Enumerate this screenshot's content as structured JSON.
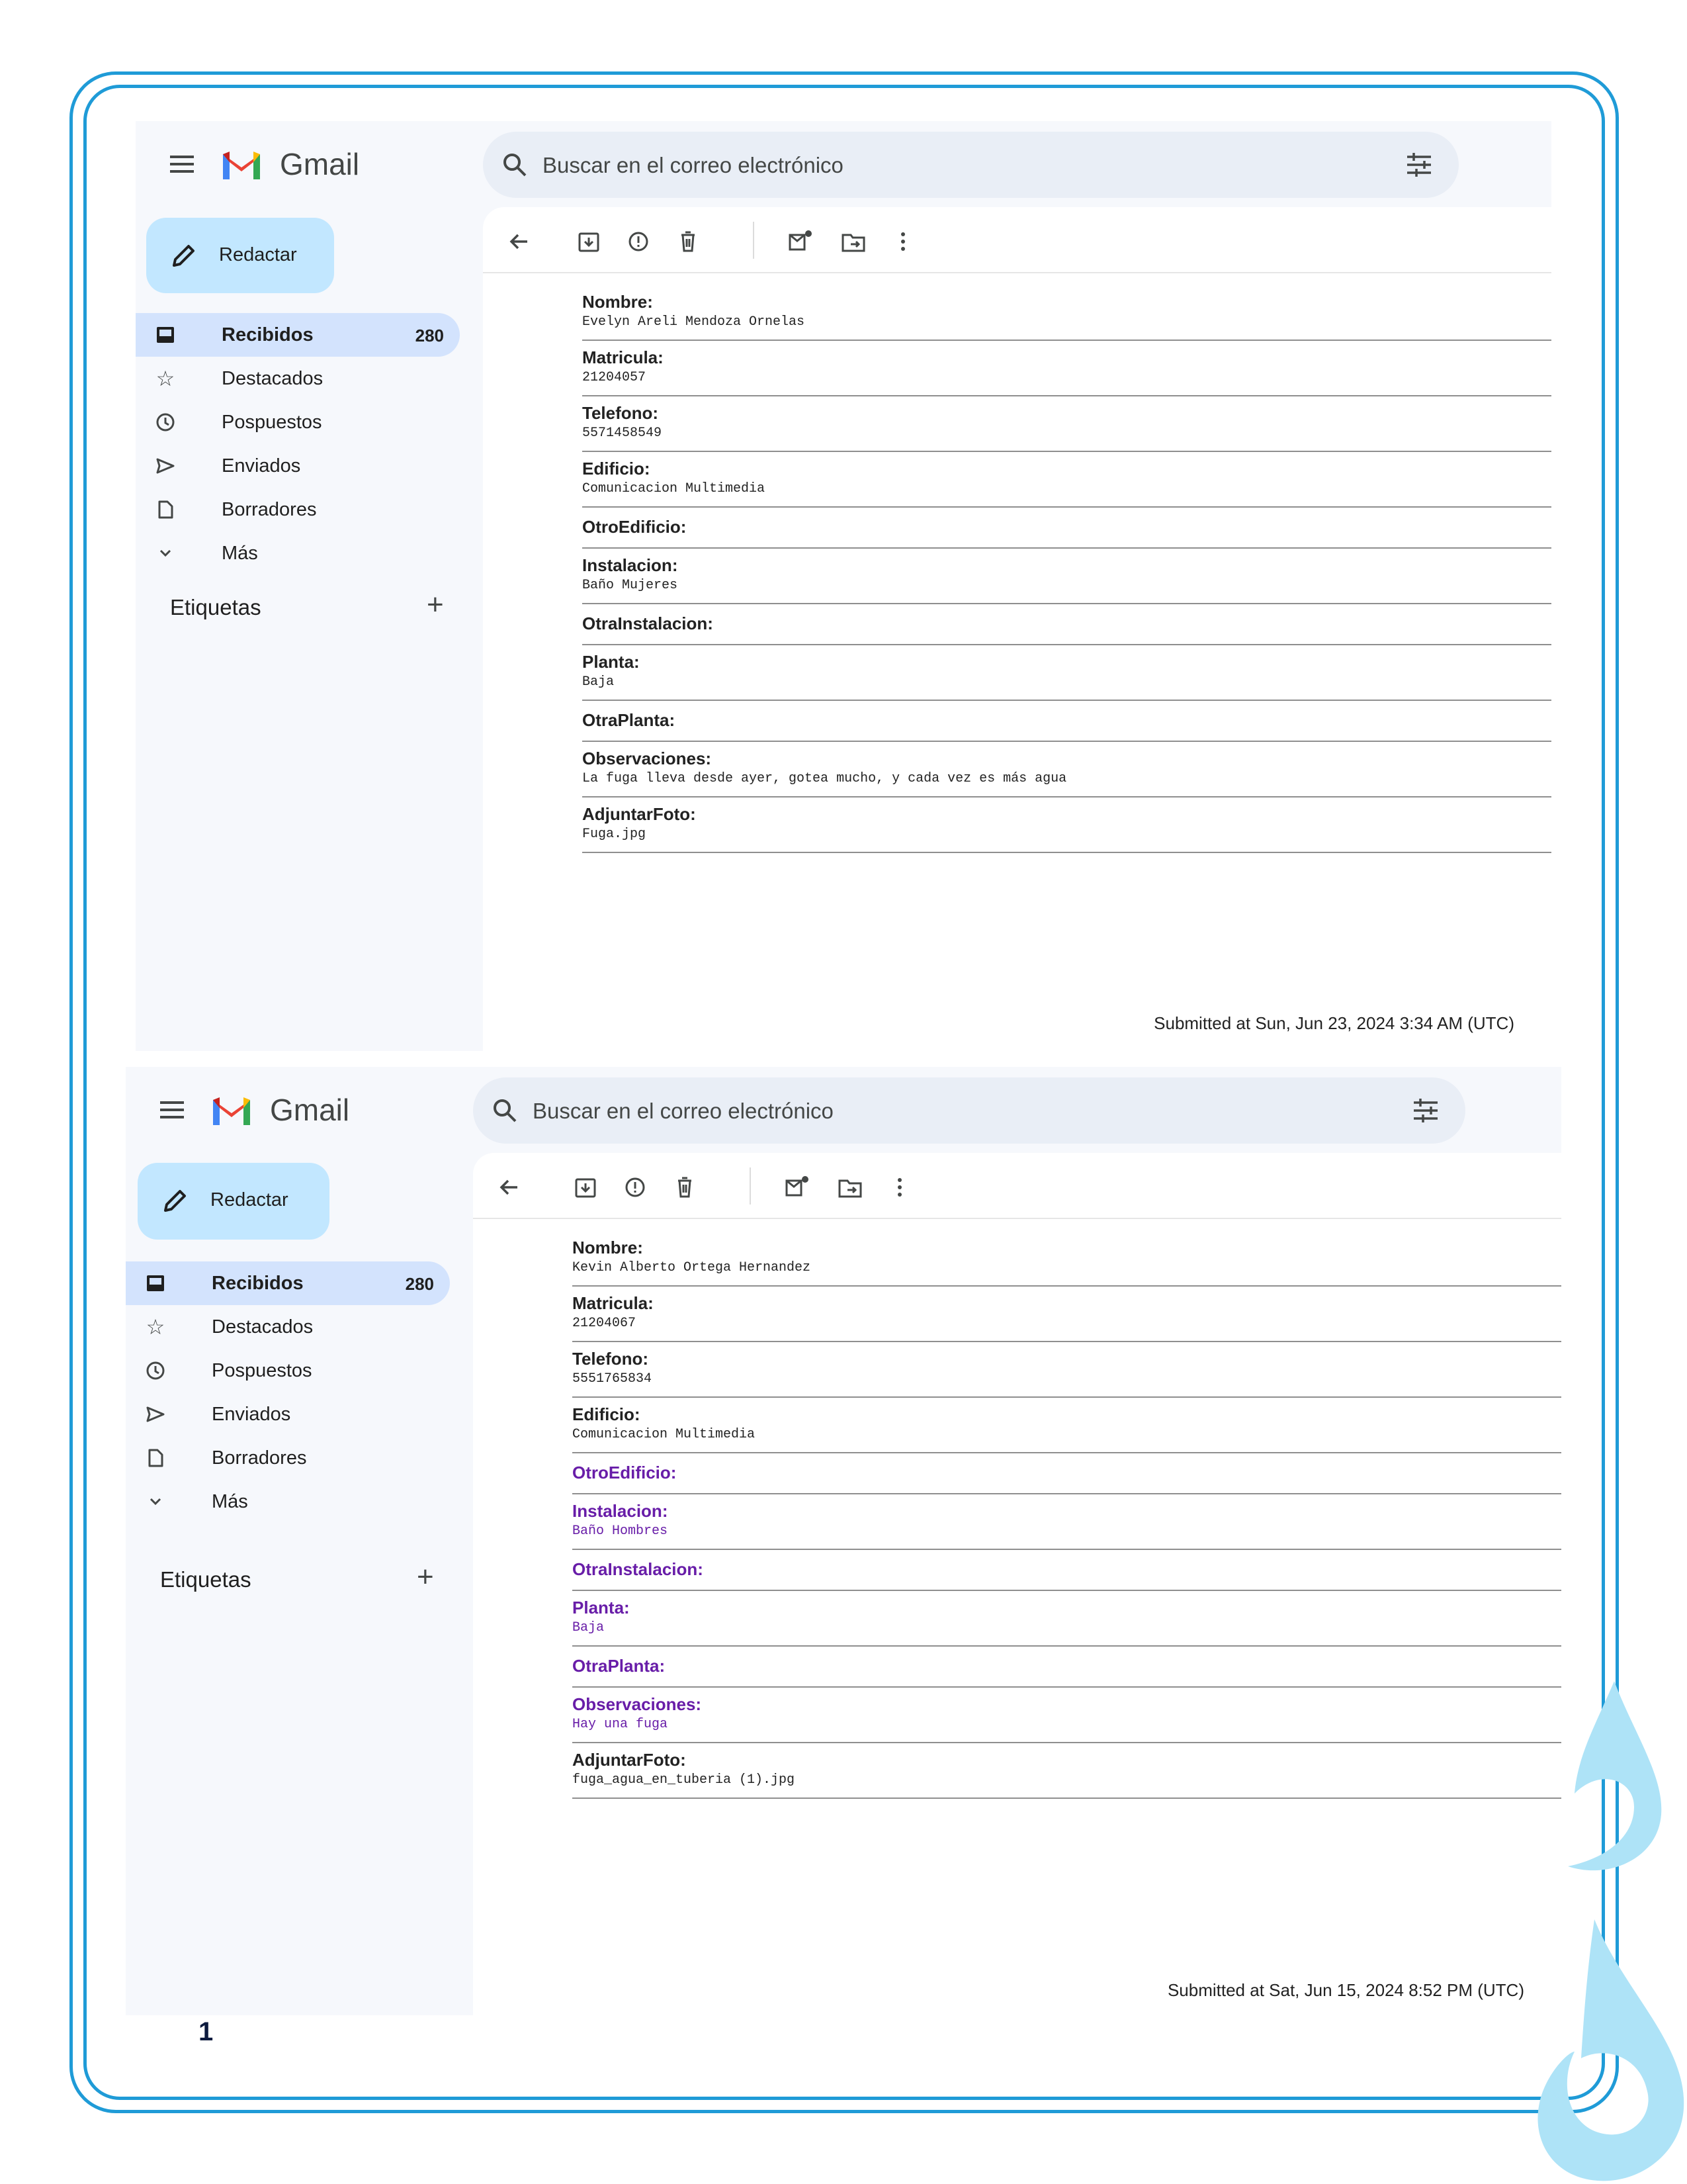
{
  "page": {
    "number": "1"
  },
  "colors": {
    "frame": "#1f9bd7",
    "droplet": "#aee3f7",
    "sidebar_active": "#d3e3fd",
    "compose": "#c2e7ff",
    "visited_link": "#681da8"
  },
  "screens": [
    {
      "app": {
        "brand": "Gmail",
        "logo": "gmail-logo"
      },
      "search": {
        "placeholder": "Buscar en el correo electrónico"
      },
      "compose": {
        "label": "Redactar"
      },
      "nav": [
        {
          "icon": "inbox-icon",
          "label": "Recibidos",
          "count": "280",
          "active": true
        },
        {
          "icon": "star-icon",
          "label": "Destacados",
          "count": ""
        },
        {
          "icon": "clock-icon",
          "label": "Pospuestos",
          "count": ""
        },
        {
          "icon": "send-icon",
          "label": "Enviados",
          "count": ""
        },
        {
          "icon": "draft-icon",
          "label": "Borradores",
          "count": ""
        },
        {
          "icon": "chevron-down-icon",
          "label": "Más",
          "count": ""
        }
      ],
      "labels_heading": "Etiquetas",
      "fields": [
        {
          "label": "Nombre:",
          "value": "Evelyn Areli Mendoza Ornelas"
        },
        {
          "label": "Matricula:",
          "value": "21204057"
        },
        {
          "label": "Telefono:",
          "value": "5571458549"
        },
        {
          "label": "Edificio:",
          "value": "Comunicacion Multimedia"
        },
        {
          "label": "OtroEdificio:",
          "value": ""
        },
        {
          "label": "Instalacion:",
          "value": "Baño Mujeres"
        },
        {
          "label": "OtraInstalacion:",
          "value": ""
        },
        {
          "label": "Planta:",
          "value": "Baja"
        },
        {
          "label": "OtraPlanta:",
          "value": ""
        },
        {
          "label": "Observaciones:",
          "value": "La fuga lleva desde ayer, gotea mucho, y cada vez es más agua"
        },
        {
          "label": "AdjuntarFoto:",
          "value": "Fuga.jpg"
        }
      ],
      "submitted": "Submitted at Sun, Jun 23, 2024 3:34 AM (UTC)"
    },
    {
      "app": {
        "brand": "Gmail",
        "logo": "gmail-logo"
      },
      "search": {
        "placeholder": "Buscar en el correo electrónico"
      },
      "compose": {
        "label": "Redactar"
      },
      "nav": [
        {
          "icon": "inbox-icon",
          "label": "Recibidos",
          "count": "280",
          "active": true
        },
        {
          "icon": "star-icon",
          "label": "Destacados",
          "count": ""
        },
        {
          "icon": "clock-icon",
          "label": "Pospuestos",
          "count": ""
        },
        {
          "icon": "send-icon",
          "label": "Enviados",
          "count": ""
        },
        {
          "icon": "draft-icon",
          "label": "Borradores",
          "count": ""
        },
        {
          "icon": "chevron-down-icon",
          "label": "Más",
          "count": ""
        }
      ],
      "labels_heading": "Etiquetas",
      "fields": [
        {
          "label": "Nombre:",
          "value": "Kevin Alberto Ortega Hernandez"
        },
        {
          "label": "Matricula:",
          "value": "21204067"
        },
        {
          "label": "Telefono:",
          "value": "5551765834"
        },
        {
          "label": "Edificio:",
          "value": "Comunicacion Multimedia"
        },
        {
          "label": "OtroEdificio:",
          "value": ""
        },
        {
          "label": "Instalacion:",
          "value": "Baño Hombres"
        },
        {
          "label": "OtraInstalacion:",
          "value": ""
        },
        {
          "label": "Planta:",
          "value": "Baja"
        },
        {
          "label": "OtraPlanta:",
          "value": ""
        },
        {
          "label": "Observaciones:",
          "value": "Hay una fuga"
        },
        {
          "label": "AdjuntarFoto:",
          "value": "fuga_agua_en_tuberia (1).jpg"
        }
      ],
      "submitted": "Submitted at Sat, Jun 15, 2024 8:52 PM (UTC)"
    }
  ]
}
